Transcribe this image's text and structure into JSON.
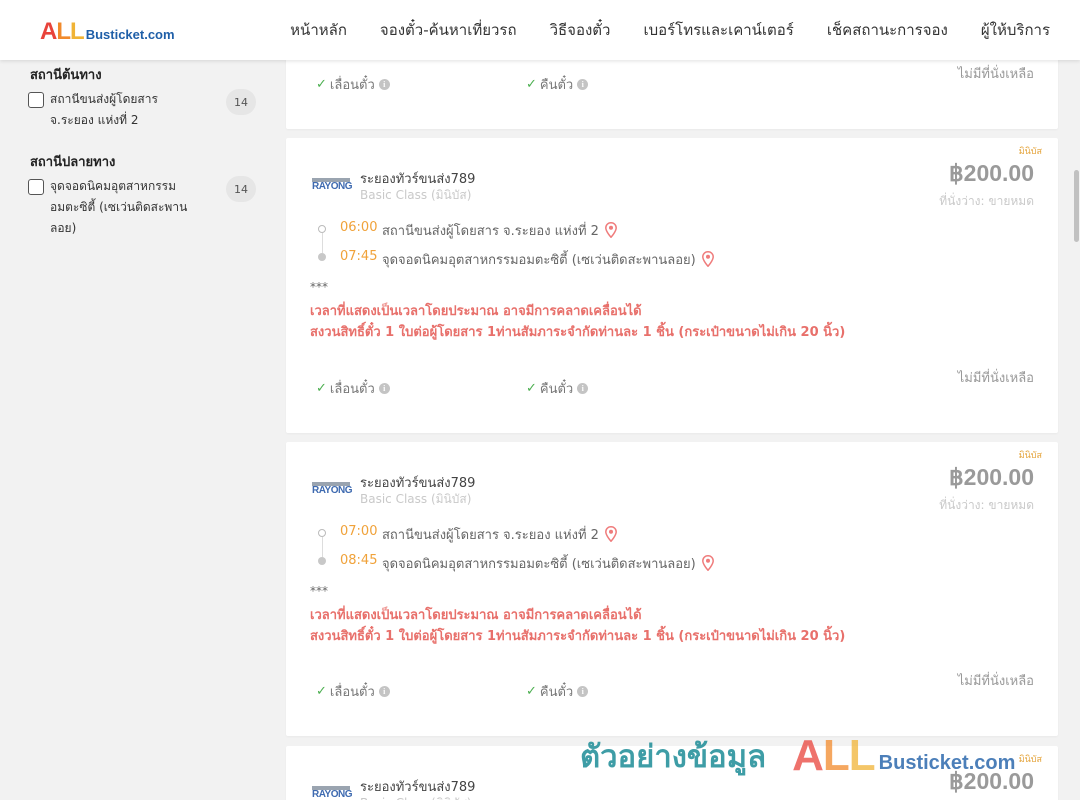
{
  "header": {
    "logo_all": [
      "A",
      "L",
      "L"
    ],
    "logo_rest": "Busticket.com",
    "nav": [
      "หน้าหลัก",
      "จองตั๋ว-ค้นหาเที่ยวรถ",
      "วิธีจองตั๋ว",
      "เบอร์โทรและเคาน์เตอร์",
      "เช็คสถานะการจอง",
      "ผู้ให้บริการ"
    ]
  },
  "sidebar": {
    "origin_title": "สถานีต้นทาง",
    "origin_items": [
      {
        "label": "สถานีขนส่งผู้โดยสาร จ.ระยอง แห่งที่ 2",
        "count": "14"
      }
    ],
    "destination_title": "สถานีปลายทาง",
    "destination_items": [
      {
        "label": "จุดจอดนิคมอุตสาหกรรม อมตะซิตี้ (เซเว่นติดสะพานลอย)",
        "count": "14"
      }
    ]
  },
  "card_common": {
    "mini_tag": "มินิบัส",
    "company_logo_text": "RAYONG",
    "company_name": "ระยองทัวร์ขนส่ง789",
    "bus_class": "Basic Class (มินิบัส)",
    "price": "฿200.00",
    "seats": "ที่นั่งว่าง: ขายหมด",
    "origin_station": "สถานีขนส่งผู้โดยสาร จ.ระยอง แห่งที่ 2",
    "destination_station": "จุดจอดนิคมอุตสาหกรรมอมตะซิตี้ (เซเว่นติดสะพานลอย)",
    "stars": "***",
    "notice_1": "เวลาที่แสดงเป็นเวลาโดยประมาณ อาจมีการคลาดเคลื่อนได้",
    "notice_2": "สงวนสิทธิ์ตั๋ว 1 ใบต่อผู้โดยสาร 1ท่านสัมภาระจำกัดท่านละ 1 ชิ้น (กระเป๋าขนาดไม่เกิน 20 นิ้ว)",
    "change_ticket": "เลื่อนตั๋ว",
    "refund_ticket": "คืนตั๋ว",
    "no_seat": "ไม่มีที่นั่งเหลือ"
  },
  "cards": [
    {
      "depart": "06:00",
      "arrive": "07:45"
    },
    {
      "depart": "07:00",
      "arrive": "08:45"
    }
  ],
  "watermark": {
    "text": "ตัวอย่างข้อมูล",
    "all": [
      "A",
      "L",
      "L"
    ],
    "rest": "Busticket.com"
  },
  "colors": {
    "accent_time": "#f0a23a",
    "notice": "#e8706b",
    "check": "#4caf50"
  }
}
